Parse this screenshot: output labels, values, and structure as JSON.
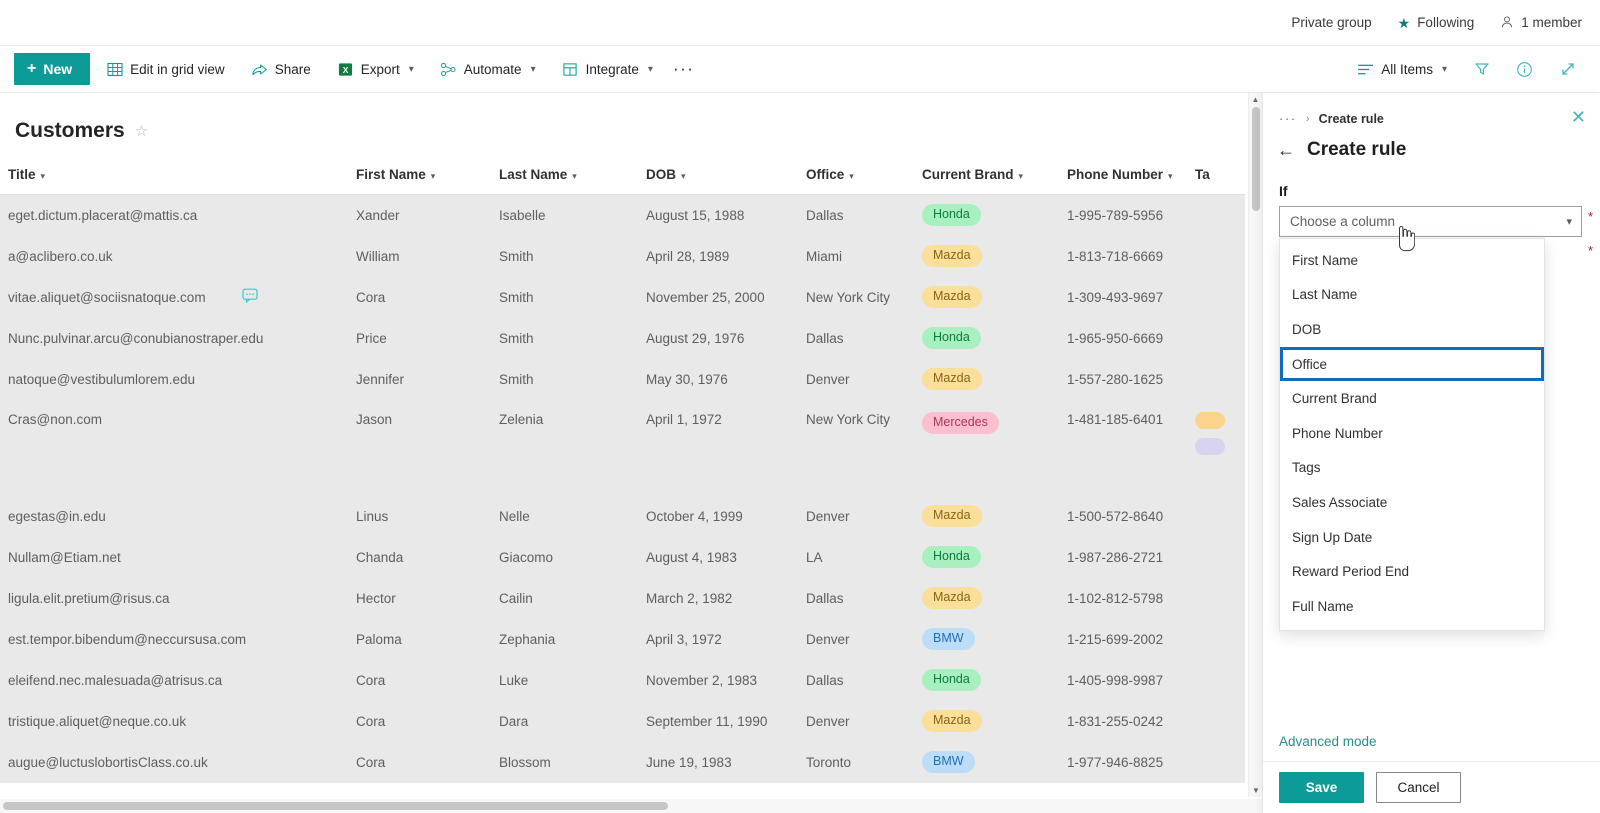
{
  "site_bar": {
    "privacy": "Private group",
    "following": "Following",
    "members": "1 member",
    "star_icon": "star-icon",
    "person_icon": "person-icon"
  },
  "command_bar": {
    "new_label": "New",
    "items": [
      {
        "label": "Edit in grid view",
        "icon": "grid-icon",
        "has_chevron": false
      },
      {
        "label": "Share",
        "icon": "share-icon",
        "has_chevron": false
      },
      {
        "label": "Export",
        "icon": "excel-icon",
        "has_chevron": true
      },
      {
        "label": "Automate",
        "icon": "automate-icon",
        "has_chevron": true
      },
      {
        "label": "Integrate",
        "icon": "integrate-icon",
        "has_chevron": true
      }
    ],
    "overflow": "···",
    "view_label": "All Items",
    "filter_icon": "filter-icon",
    "info_icon": "info-icon",
    "expand_icon": "expand-icon"
  },
  "list": {
    "title": "Customers",
    "favorite_icon": "star-outline-icon",
    "columns": [
      "Title",
      "First Name",
      "Last Name",
      "DOB",
      "Office",
      "Current Brand",
      "Phone Number",
      "Ta"
    ],
    "rows": [
      {
        "title": "eget.dictum.placerat@mattis.ca",
        "first": "Xander",
        "last": "Isabelle",
        "dob": "August 15, 1988",
        "office": "Dallas",
        "brand": "Honda",
        "brand_class": "pill-honda",
        "phone": "1-995-789-5956",
        "comment": false
      },
      {
        "title": "a@aclibero.co.uk",
        "first": "William",
        "last": "Smith",
        "dob": "April 28, 1989",
        "office": "Miami",
        "brand": "Mazda",
        "brand_class": "pill-mazda",
        "phone": "1-813-718-6669",
        "comment": false
      },
      {
        "title": "vitae.aliquet@sociisnatoque.com",
        "first": "Cora",
        "last": "Smith",
        "dob": "November 25, 2000",
        "office": "New York City",
        "brand": "Mazda",
        "brand_class": "pill-mazda",
        "phone": "1-309-493-9697",
        "comment": true
      },
      {
        "title": "Nunc.pulvinar.arcu@conubianostraper.edu",
        "first": "Price",
        "last": "Smith",
        "dob": "August 29, 1976",
        "office": "Dallas",
        "brand": "Honda",
        "brand_class": "pill-honda",
        "phone": "1-965-950-6669",
        "comment": false
      },
      {
        "title": "natoque@vestibulumlorem.edu",
        "first": "Jennifer",
        "last": "Smith",
        "dob": "May 30, 1976",
        "office": "Denver",
        "brand": "Mazda",
        "brand_class": "pill-mazda",
        "phone": "1-557-280-1625",
        "comment": false
      },
      {
        "title": "Cras@non.com",
        "first": "Jason",
        "last": "Zelenia",
        "dob": "April 1, 1972",
        "office": "New York City",
        "brand": "Mercedes",
        "brand_class": "pill-mercedes",
        "phone": "1-481-185-6401",
        "comment": false,
        "tall": true
      },
      {
        "title": "egestas@in.edu",
        "first": "Linus",
        "last": "Nelle",
        "dob": "October 4, 1999",
        "office": "Denver",
        "brand": "Mazda",
        "brand_class": "pill-mazda",
        "phone": "1-500-572-8640",
        "comment": false
      },
      {
        "title": "Nullam@Etiam.net",
        "first": "Chanda",
        "last": "Giacomo",
        "dob": "August 4, 1983",
        "office": "LA",
        "brand": "Honda",
        "brand_class": "pill-honda",
        "phone": "1-987-286-2721",
        "comment": false
      },
      {
        "title": "ligula.elit.pretium@risus.ca",
        "first": "Hector",
        "last": "Cailin",
        "dob": "March 2, 1982",
        "office": "Dallas",
        "brand": "Mazda",
        "brand_class": "pill-mazda",
        "phone": "1-102-812-5798",
        "comment": false
      },
      {
        "title": "est.tempor.bibendum@neccursusa.com",
        "first": "Paloma",
        "last": "Zephania",
        "dob": "April 3, 1972",
        "office": "Denver",
        "brand": "BMW",
        "brand_class": "pill-bmw",
        "phone": "1-215-699-2002",
        "comment": false
      },
      {
        "title": "eleifend.nec.malesuada@atrisus.ca",
        "first": "Cora",
        "last": "Luke",
        "dob": "November 2, 1983",
        "office": "Dallas",
        "brand": "Honda",
        "brand_class": "pill-honda",
        "phone": "1-405-998-9987",
        "comment": false
      },
      {
        "title": "tristique.aliquet@neque.co.uk",
        "first": "Cora",
        "last": "Dara",
        "dob": "September 11, 1990",
        "office": "Denver",
        "brand": "Mazda",
        "brand_class": "pill-mazda",
        "phone": "1-831-255-0242",
        "comment": false
      },
      {
        "title": "augue@luctuslobortisClass.co.uk",
        "first": "Cora",
        "last": "Blossom",
        "dob": "June 19, 1983",
        "office": "Toronto",
        "brand": "BMW",
        "brand_class": "pill-bmw",
        "phone": "1-977-946-8825",
        "comment": false
      }
    ]
  },
  "panel": {
    "breadcrumb_overflow": "···",
    "breadcrumb_sep": "›",
    "breadcrumb_current": "Create rule",
    "close_icon": "close-icon",
    "back_icon": "back-arrow-icon",
    "title": "Create rule",
    "if_label": "If",
    "column_picker": {
      "value": "Choose a column",
      "chevron_icon": "chevron-down-icon",
      "required_marker": "*",
      "options": [
        "First Name",
        "Last Name",
        "DOB",
        "Office",
        "Current Brand",
        "Phone Number",
        "Tags",
        "Sales Associate",
        "Sign Up Date",
        "Reward Period End",
        "Full Name"
      ],
      "focused_option": "Office"
    },
    "advanced_mode": "Advanced mode",
    "save_label": "Save",
    "cancel_label": "Cancel"
  },
  "colors": {
    "accent_teal": "#0d9b98",
    "focus_blue": "#0f6cbd",
    "required_red": "#a4262c",
    "row_bg": "#e9e9e9"
  }
}
